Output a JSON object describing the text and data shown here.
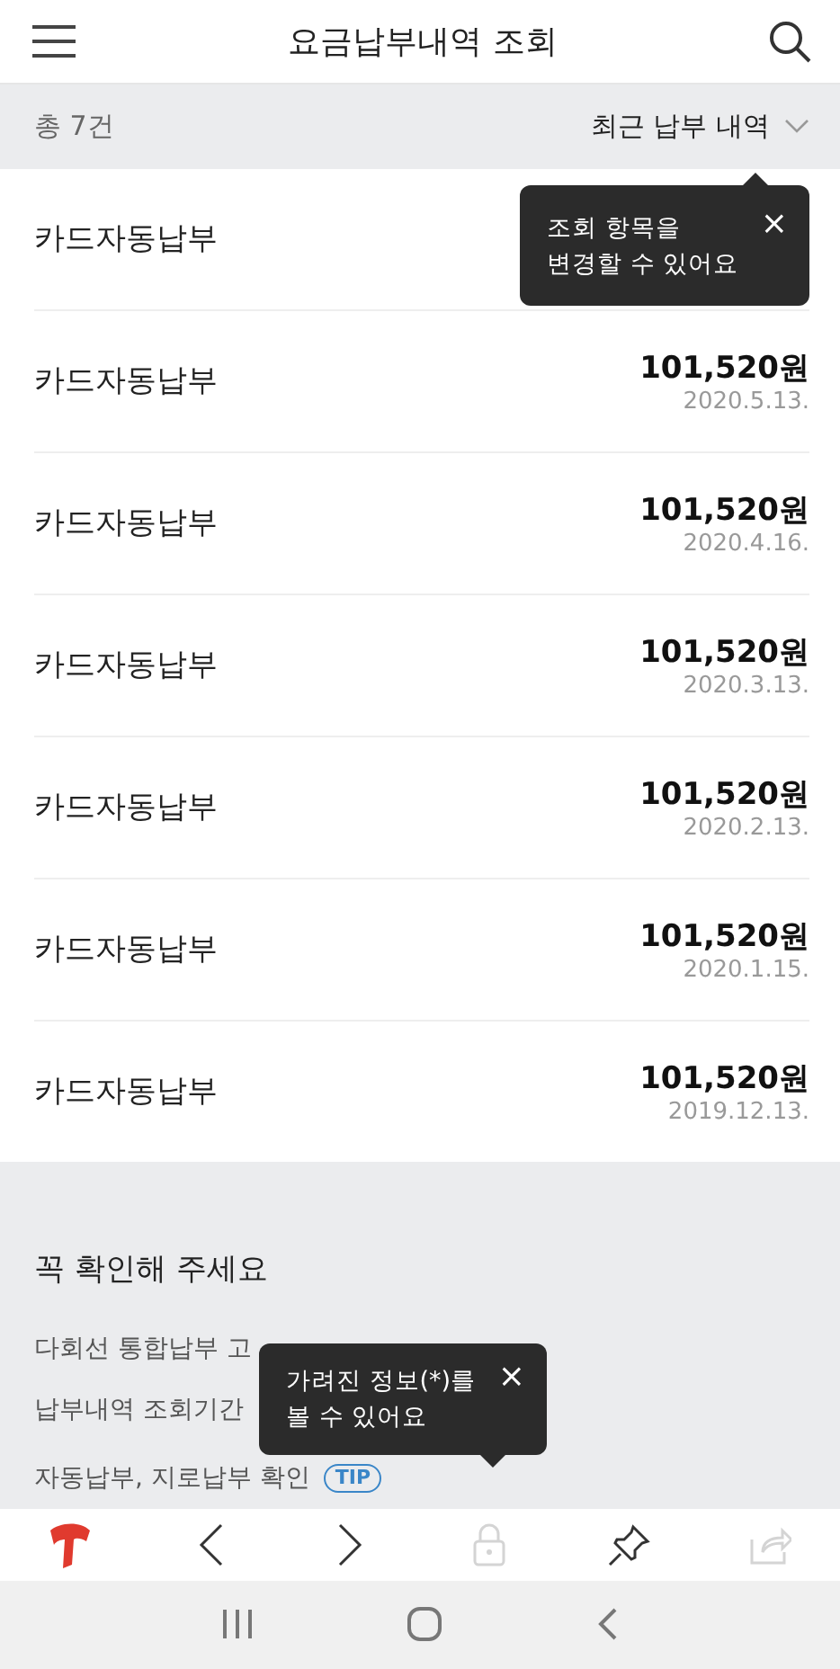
{
  "header": {
    "title": "요금납부내역 조회"
  },
  "filter_bar": {
    "count": "총 7건",
    "sort": "최근 납부 내역"
  },
  "payments": [
    {
      "method": "카드자동납부"
    },
    {
      "method": "카드자동납부",
      "amount": "101,520원",
      "date": "2020.5.13."
    },
    {
      "method": "카드자동납부",
      "amount": "101,520원",
      "date": "2020.4.16."
    },
    {
      "method": "카드자동납부",
      "amount": "101,520원",
      "date": "2020.3.13."
    },
    {
      "method": "카드자동납부",
      "amount": "101,520원",
      "date": "2020.2.13."
    },
    {
      "method": "카드자동납부",
      "amount": "101,520원",
      "date": "2020.1.15."
    },
    {
      "method": "카드자동납부",
      "amount": "101,520원",
      "date": "2019.12.13."
    }
  ],
  "notice": {
    "title": "꼭 확인해 주세요",
    "items": [
      {
        "text": "다회선 통합납부 고"
      },
      {
        "text": "납부내역 조회기간"
      },
      {
        "text": "자동납부, 지로납부 확인",
        "tip": true,
        "tip_label": "TIP"
      }
    ]
  },
  "tooltips": [
    {
      "text": "조회 항목을\n변경할 수 있어요",
      "close": "×"
    },
    {
      "text": "가려진 정보(*)를\n볼 수 있어요",
      "close": "×"
    }
  ],
  "toolbar": [
    {
      "kind": "logo",
      "disabled": false
    },
    {
      "kind": "back",
      "disabled": false
    },
    {
      "kind": "forward",
      "disabled": false
    },
    {
      "kind": "lock",
      "disabled": true
    },
    {
      "kind": "pin",
      "disabled": false
    },
    {
      "kind": "share",
      "disabled": true
    }
  ]
}
